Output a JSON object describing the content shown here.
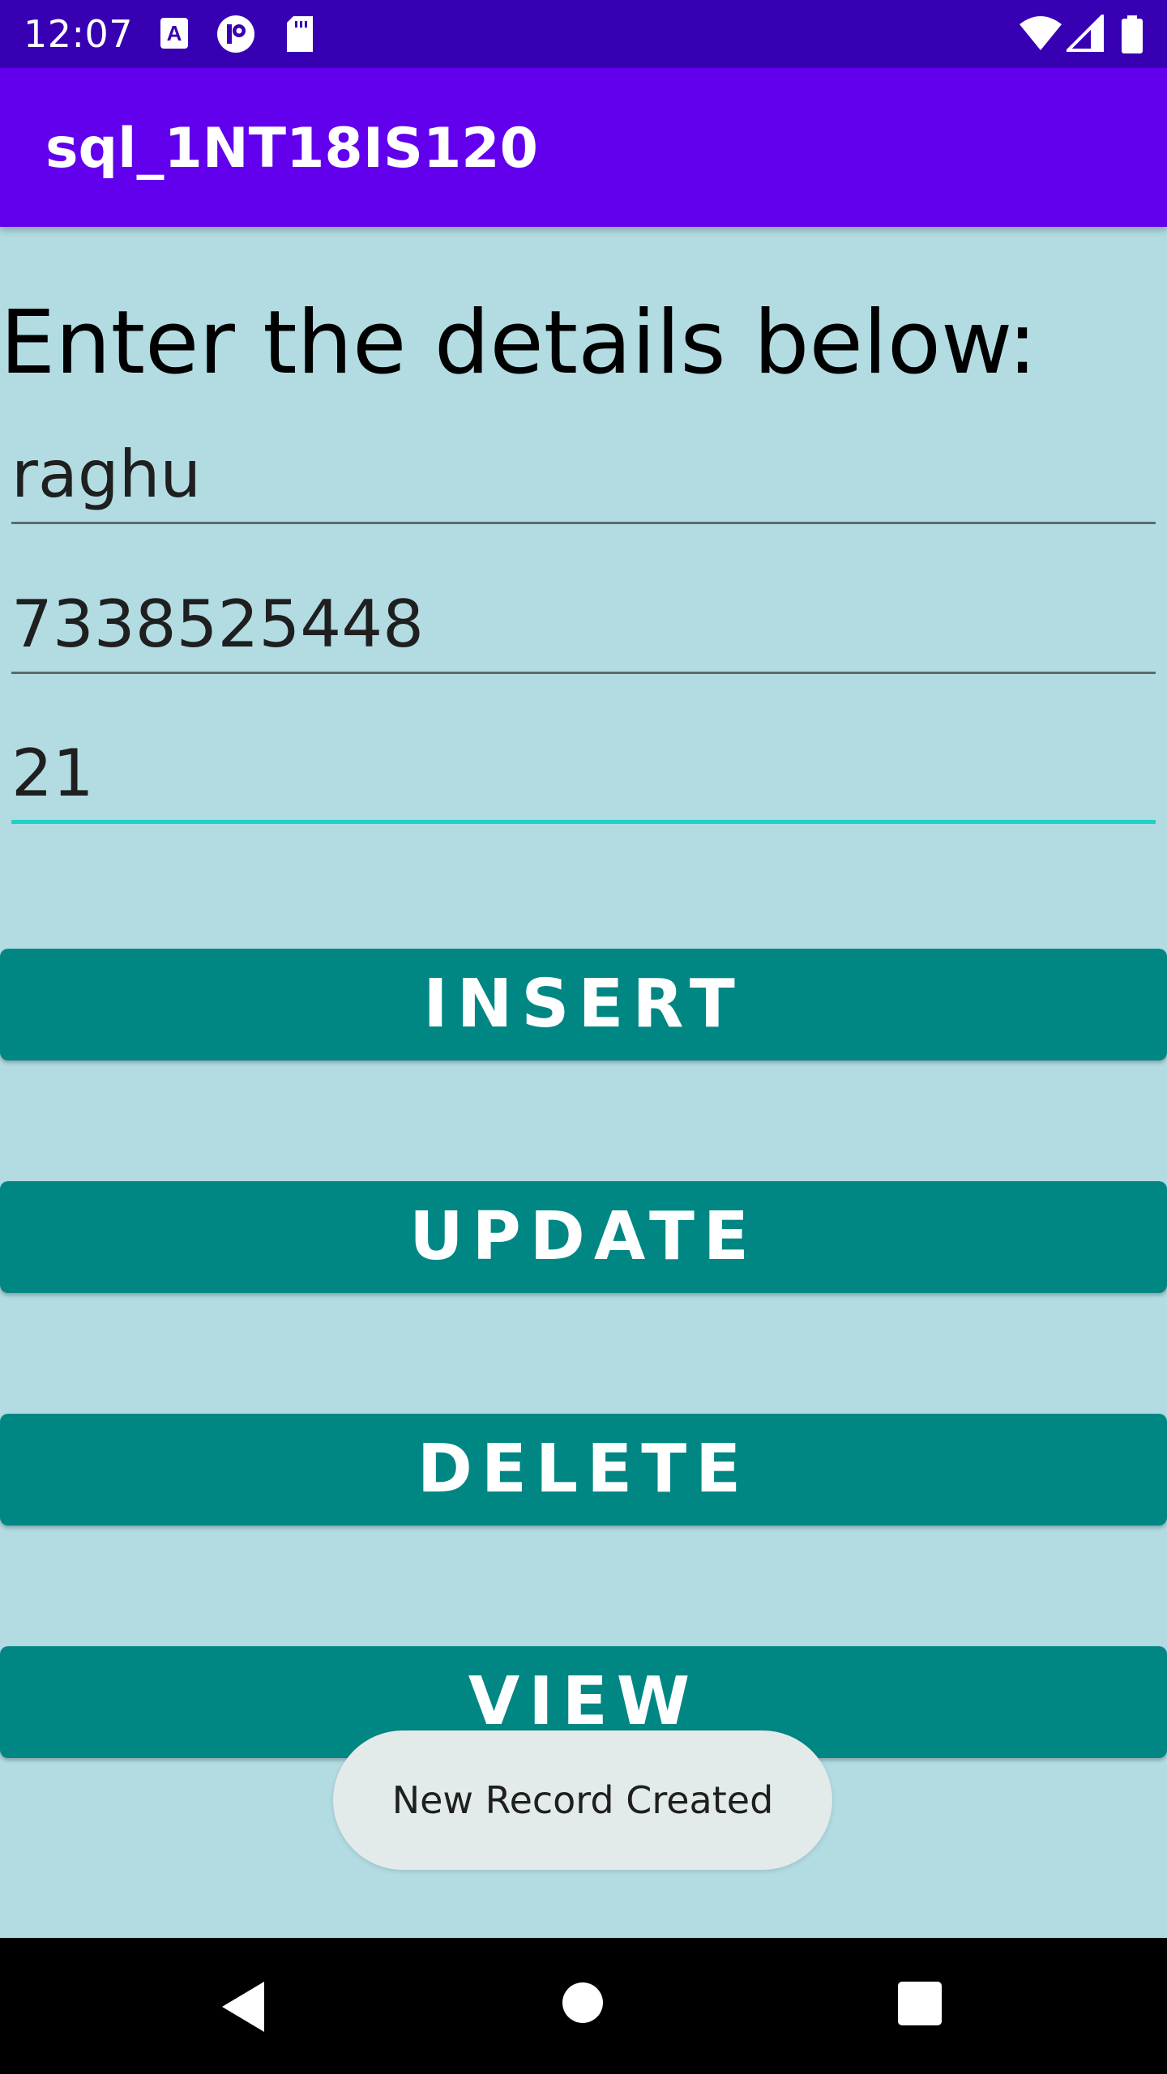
{
  "status_bar": {
    "time": "12:07",
    "left_icons": [
      "a-badge-icon",
      "circle-p-icon",
      "sd-card-icon"
    ],
    "right_icons": [
      "wifi-icon",
      "signal-icon",
      "battery-icon"
    ]
  },
  "app_bar": {
    "title": "sql_1NT18IS120"
  },
  "form": {
    "heading": "Enter the details below:",
    "fields": [
      {
        "value": "raghu"
      },
      {
        "value": "7338525448"
      },
      {
        "value": "21"
      }
    ]
  },
  "buttons": {
    "insert": "INSERT",
    "update": "UPDATE",
    "delete": "DELETE",
    "view": "VIEW"
  },
  "toast": {
    "message": "New Record Created"
  },
  "nav_bar": {
    "icons": [
      "back-icon",
      "home-icon",
      "recents-icon"
    ]
  },
  "colors": {
    "status_bar": "#3700b3",
    "app_bar": "#6200ee",
    "background": "#b2dce2",
    "button": "#008784",
    "focus_underline": "#1ed2c8"
  }
}
